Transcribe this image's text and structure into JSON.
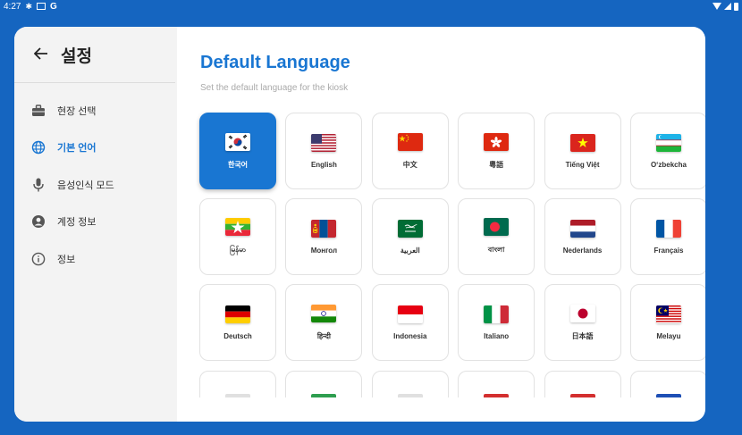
{
  "status": {
    "time": "4:27"
  },
  "sidebar": {
    "title": "설정",
    "items": [
      {
        "label": "현장 선택",
        "icon": "briefcase-icon"
      },
      {
        "label": "기본 언어",
        "icon": "globe-icon",
        "active": true
      },
      {
        "label": "음성인식 모드",
        "icon": "microphone-icon"
      },
      {
        "label": "계정 정보",
        "icon": "account-icon"
      },
      {
        "label": "정보",
        "icon": "info-icon"
      }
    ]
  },
  "main": {
    "title": "Default Language",
    "subtitle": "Set the default language for the kiosk",
    "languages": [
      {
        "label": "한국어",
        "flag": "kr",
        "selected": true
      },
      {
        "label": "English",
        "flag": "us"
      },
      {
        "label": "中文",
        "flag": "cn"
      },
      {
        "label": "粵語",
        "flag": "hk"
      },
      {
        "label": "Tiếng Việt",
        "flag": "vn"
      },
      {
        "label": "O‘zbekcha",
        "flag": "uz"
      },
      {
        "label": "မြန်မာ",
        "flag": "mm"
      },
      {
        "label": "Монгол",
        "flag": "mn"
      },
      {
        "label": "العربية",
        "flag": "sa"
      },
      {
        "label": "বাংলা",
        "flag": "bd"
      },
      {
        "label": "Nederlands",
        "flag": "nl"
      },
      {
        "label": "Français",
        "flag": "fr"
      },
      {
        "label": "Deutsch",
        "flag": "de"
      },
      {
        "label": "हिन्दी",
        "flag": "in"
      },
      {
        "label": "Indonesia",
        "flag": "id"
      },
      {
        "label": "Italiano",
        "flag": "it"
      },
      {
        "label": "日本語",
        "flag": "jp"
      },
      {
        "label": "Melayu",
        "flag": "my"
      }
    ],
    "partial_flag_colors": [
      "#e0e0e0",
      "#2e9e4f",
      "#e0e0e0",
      "#d32f2f",
      "#d32f2f",
      "#1e4fb5"
    ]
  },
  "colors": {
    "accent": "#1976d2",
    "frame": "#1565c0"
  }
}
